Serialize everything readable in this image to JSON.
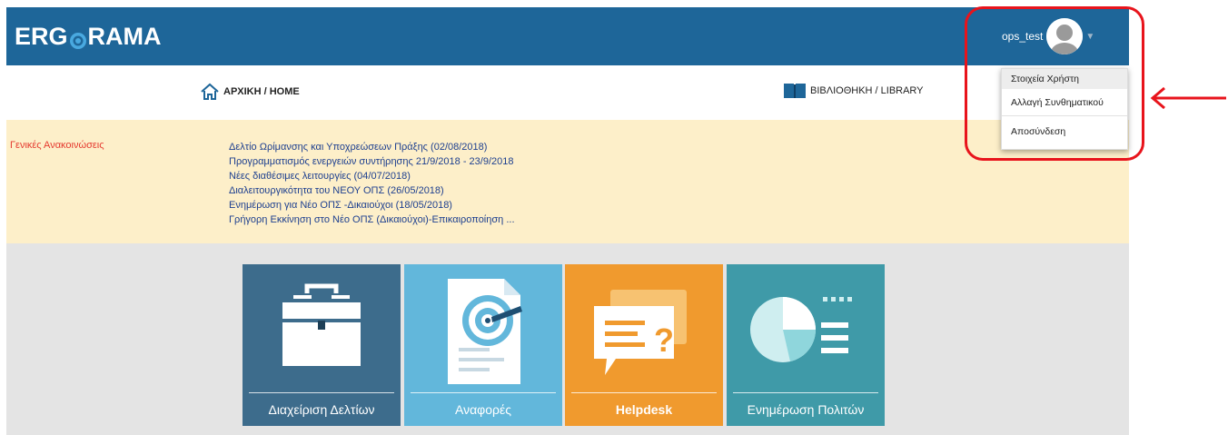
{
  "header": {
    "logo_text_left": "ERG",
    "logo_text_right": "RAMA",
    "username": "ops_test"
  },
  "nav": {
    "home_label": "ΑΡΧΙΚΗ / HOME",
    "library_label": "ΒΙΒΛΙΟΘΗΚΗ / LIBRARY"
  },
  "announcements": {
    "title": "Γενικές Ανακοινώσεις",
    "items": [
      "Δελτίο Ωρίμανσης και Υποχρεώσεων Πράξης (02/08/2018)",
      "Προγραμματισμός ενεργειών συντήρησης 21/9/2018 - 23/9/2018",
      "Νέες διαθέσιμες λειτουργίες (04/07/2018)",
      "Διαλειτουργικότητα του ΝΕΟΥ ΟΠΣ (26/05/2018)",
      "Ενημέρωση για Νέο ΟΠΣ -Δικαιούχοι (18/05/2018)",
      "Γρήγορη Εκκίνηση στο Νέο ΟΠΣ (Δικαιούχοι)-Επικαιροποίηση ..."
    ]
  },
  "tiles": [
    {
      "label": "Διαχείριση Δελτίων",
      "color": "#3d6c8c"
    },
    {
      "label": "Αναφορές",
      "color": "#62b7db"
    },
    {
      "label": "Helpdesk",
      "color": "#f09a2e"
    },
    {
      "label": "Ενημέρωση Πολιτών",
      "color": "#3f9aa8"
    }
  ],
  "user_menu": {
    "items": [
      "Στοιχεία Χρήστη",
      "Αλλαγή Συνθηματικού",
      "Αποσύνδεση"
    ]
  },
  "colors": {
    "header_bg": "#1e6699",
    "announce_bg": "#fdefc9",
    "annotation_red": "#e8141c"
  }
}
